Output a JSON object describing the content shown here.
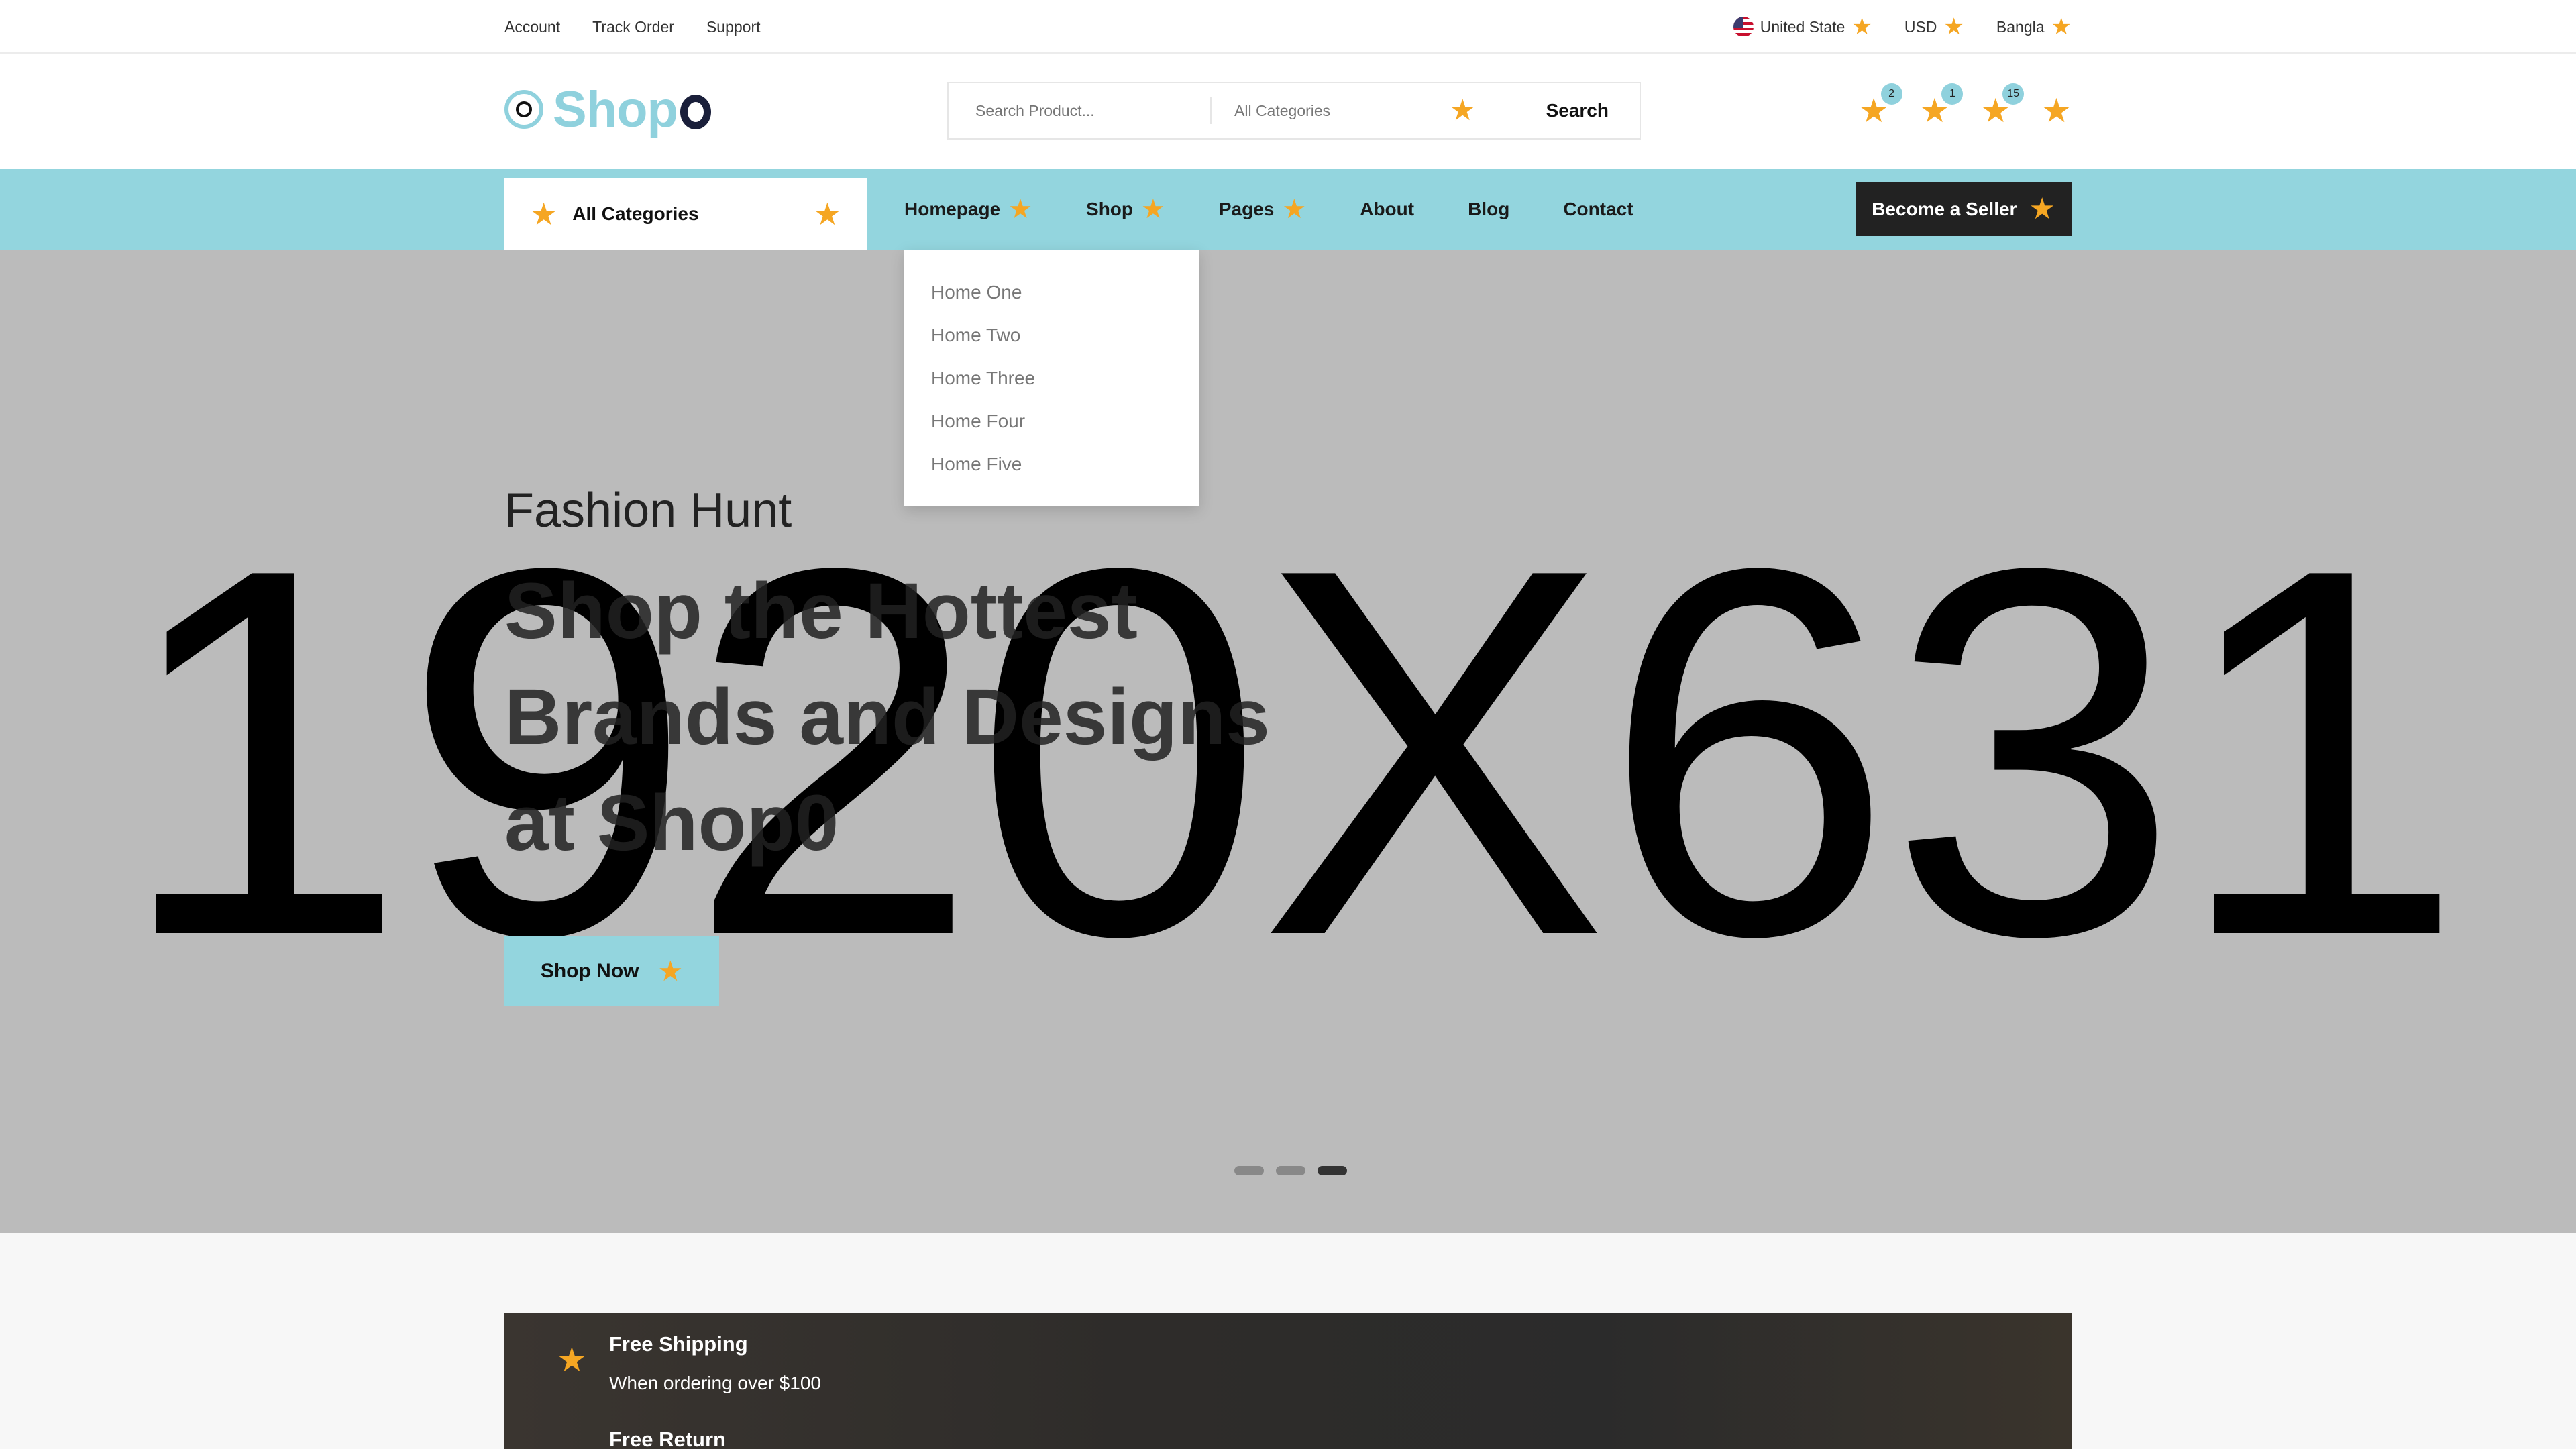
{
  "topbar": {
    "links": [
      "Account",
      "Track Order",
      "Support"
    ],
    "country": "United State",
    "currency": "USD",
    "language": "Bangla"
  },
  "header": {
    "logo_text": "Shop",
    "search_placeholder": "Search Product...",
    "category_select": "All Categories",
    "search_button": "Search",
    "icons": [
      {
        "name": "compare-icon",
        "badge": "2"
      },
      {
        "name": "wishlist-icon",
        "badge": "1"
      },
      {
        "name": "cart-icon",
        "badge": "15"
      },
      {
        "name": "user-icon",
        "badge": ""
      }
    ]
  },
  "nav": {
    "all_categories": "All Categories",
    "items": [
      "Homepage",
      "Shop",
      "Pages",
      "About",
      "Blog",
      "Contact"
    ],
    "seller_button": "Become a Seller",
    "dropdown": [
      "Home One",
      "Home Two",
      "Home Three",
      "Home Four",
      "Home Five"
    ]
  },
  "hero": {
    "placeholder": "1920X631",
    "subtitle": "Fashion Hunt",
    "headline_lines": [
      "Shop the Hottest",
      "Brands and Designs",
      "at Shop0"
    ],
    "cta": "Shop Now",
    "slides": 3,
    "active_slide": 3
  },
  "features": [
    {
      "title": "Free Shipping",
      "desc": "When ordering over $100"
    },
    {
      "title": "Free Return",
      "desc": ""
    }
  ],
  "colors": {
    "accent": "#93d5de",
    "star": "#f5a623",
    "dark": "#222222",
    "hero_bg": "#bbbbbb"
  }
}
